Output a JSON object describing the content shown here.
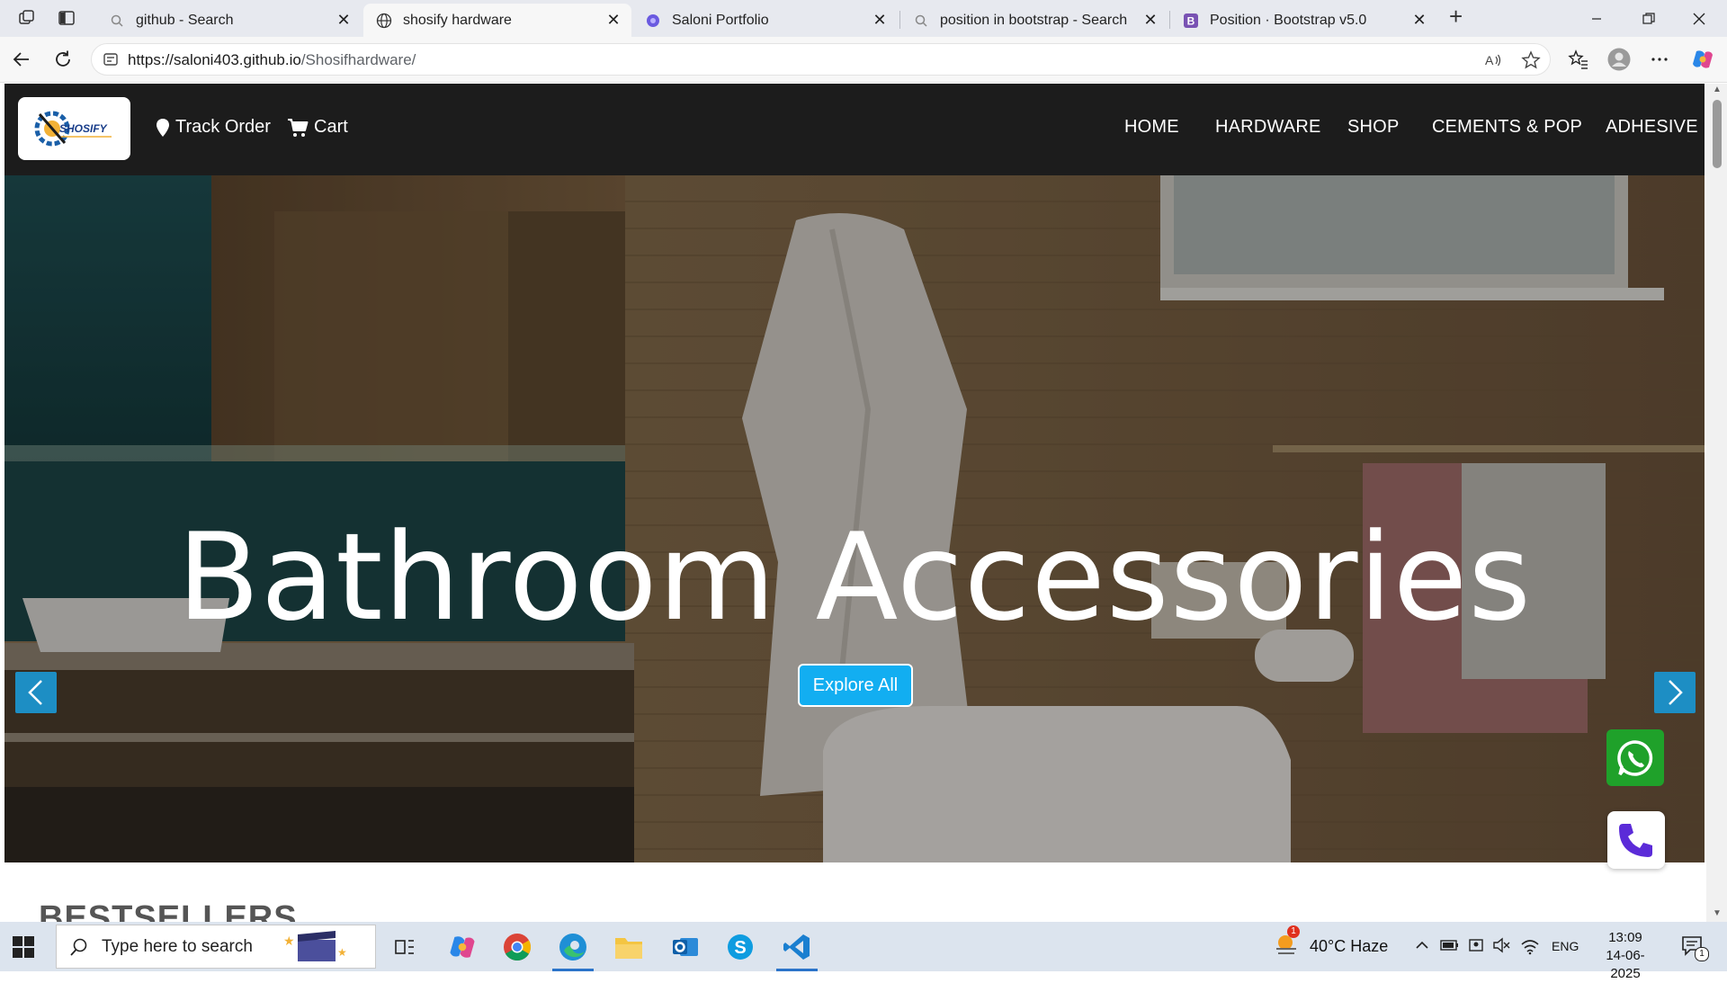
{
  "browser": {
    "tabs": [
      {
        "title": "github - Search",
        "icon": "search-icon",
        "active": false
      },
      {
        "title": "shosify hardware",
        "icon": "globe-icon",
        "active": true
      },
      {
        "title": "Saloni Portfolio",
        "icon": "portfolio-icon",
        "active": false
      },
      {
        "title": "position in bootstrap - Search",
        "icon": "search-icon",
        "active": false
      },
      {
        "title": "Position · Bootstrap v5.0",
        "icon": "bootstrap-icon",
        "active": false
      }
    ],
    "url_host": "https://saloni403.github.io",
    "url_path": "/Shosifhardware/"
  },
  "site": {
    "logo_text": "SHOSIFY",
    "nav_left": [
      {
        "label": "Track Order",
        "icon": "map-pin-icon"
      },
      {
        "label": "Cart",
        "icon": "cart-icon"
      }
    ],
    "menu": [
      "HOME",
      "HARDWARE",
      "SHOP",
      "CEMENTS & POP",
      "ADHESIVE"
    ]
  },
  "hero": {
    "title": "Bathroom Accessories",
    "button": "Explore All"
  },
  "section": {
    "title": "BESTSELLERS"
  },
  "colors": {
    "navbar": "#1c1c1c",
    "accent": "#12aef1",
    "carousel_control": "#1d8ec4",
    "whatsapp": "#1fa12a",
    "phone": "#5b2bd8"
  },
  "taskbar": {
    "search_placeholder": "Type here to search",
    "weather": "40°C  Haze",
    "weather_badge": "1",
    "language": "ENG",
    "time": "13:09",
    "date": "14-06-2025",
    "notifications": "1"
  }
}
